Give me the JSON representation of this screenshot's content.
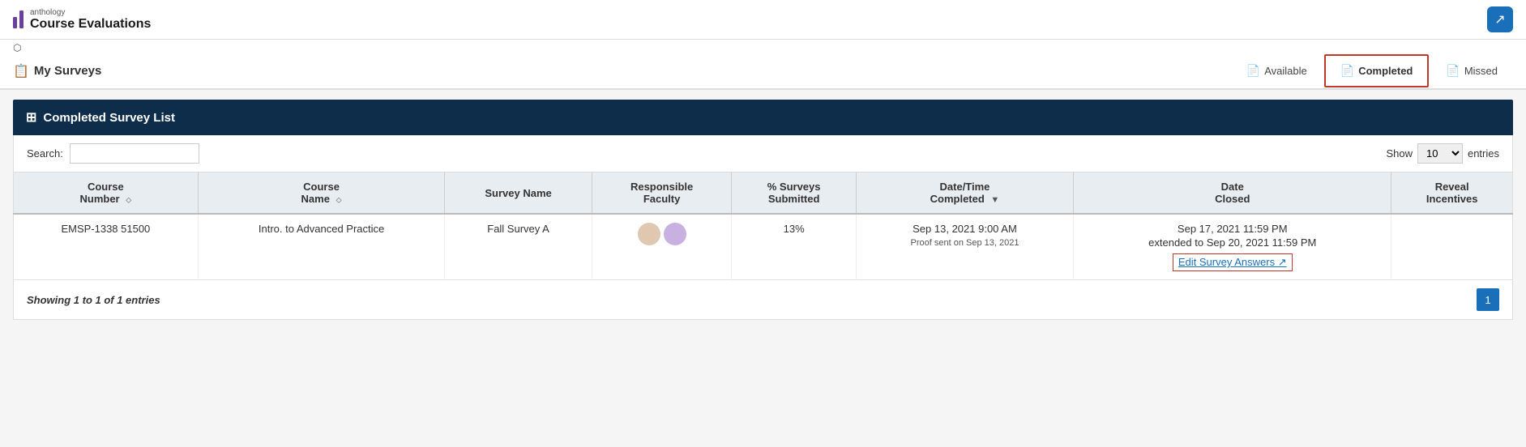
{
  "app": {
    "logo_top": "anthology",
    "logo_bottom": "Course Evaluations",
    "external_icon_label": "↗"
  },
  "sub_header": {
    "external_link_label": "⬡",
    "title_icon": "📋",
    "title": "My Surveys"
  },
  "nav_tabs": [
    {
      "id": "available",
      "label": "Available",
      "icon": "📄",
      "active": false
    },
    {
      "id": "completed",
      "label": "Completed",
      "icon": "📄",
      "active": true
    },
    {
      "id": "missed",
      "label": "Missed",
      "icon": "📄",
      "active": false
    }
  ],
  "section": {
    "icon": "⊞",
    "title": "Completed Survey List"
  },
  "table_controls": {
    "search_label": "Search:",
    "search_placeholder": "",
    "show_label": "Show",
    "show_value": "10",
    "show_options": [
      "10",
      "25",
      "50",
      "100"
    ],
    "entries_label": "entries"
  },
  "table_headers": [
    {
      "label": "Course\nNumber",
      "sortable": true
    },
    {
      "label": "Course\nName",
      "sortable": true
    },
    {
      "label": "Survey Name",
      "sortable": false
    },
    {
      "label": "Responsible\nFaculty",
      "sortable": false
    },
    {
      "label": "% Surveys\nSubmitted",
      "sortable": false
    },
    {
      "label": "Date/Time\nCompleted",
      "sortable": true,
      "sort_active": true
    },
    {
      "label": "Date\nClosed",
      "sortable": false
    },
    {
      "label": "Reveal\nIncentives",
      "sortable": false
    }
  ],
  "table_rows": [
    {
      "course_number": "EMSP-1338 51500",
      "course_name": "Intro. to Advanced Practice",
      "survey_name": "Fall Survey A",
      "percent_submitted": "13%",
      "date_completed": "Sep 13, 2021 9:00 AM",
      "proof_sent": "Proof sent on Sep 13, 2021",
      "date_closed": "Sep 17, 2021 11:59 PM",
      "date_extended": "extended to Sep 20, 2021 11:59 PM",
      "edit_survey_label": "Edit Survey Answers ↗",
      "reveal_incentives": ""
    }
  ],
  "footer": {
    "showing_text": "Showing 1 to 1 of 1 entries",
    "page_number": "1"
  }
}
